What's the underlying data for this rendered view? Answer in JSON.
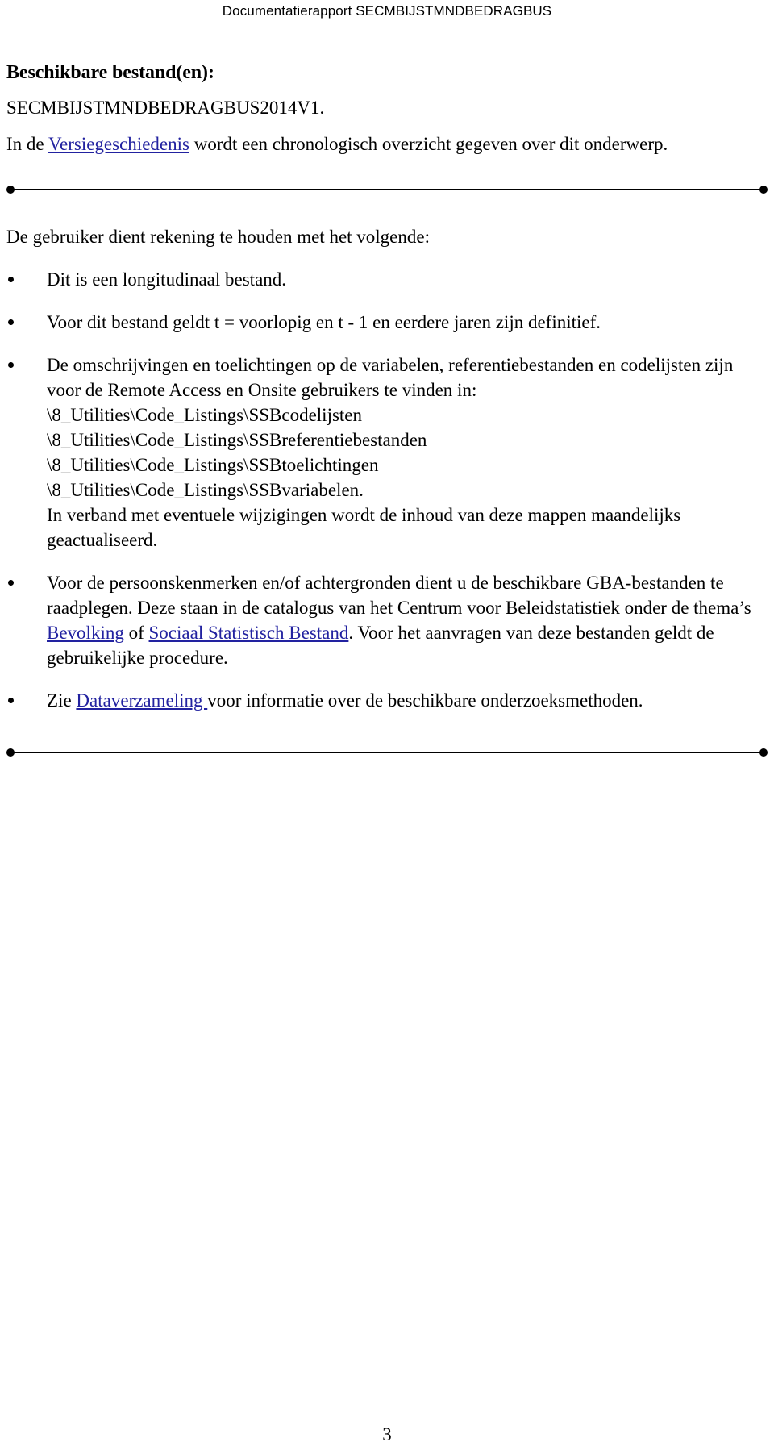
{
  "header": {
    "running_title": "Documentatierapport SECMBIJSTMNDBEDRAGBUS"
  },
  "content": {
    "heading_available_files": "Beschikbare bestand(en):",
    "file_name": "SECMBIJSTMNDBEDRAGBUS2014V1.",
    "version_history": {
      "prefix": "In de ",
      "link_text": "Versiegeschiedenis",
      "suffix": " wordt een chronologisch overzicht gegeven over dit onderwerp."
    },
    "lead_in": "De gebruiker dient rekening te houden met het volgende:",
    "bullets": [
      {
        "id": "longitudinal",
        "text": "Dit is een longitudinaal bestand."
      },
      {
        "id": "t-definitief",
        "text": "Voor dit bestand geldt t = voorlopig en t - 1 en eerdere jaren zijn definitief."
      },
      {
        "id": "omschrijvingen",
        "intro": "De omschrijvingen en toelichtingen op de variabelen, referentiebestanden en codelijsten zijn voor de Remote Access en Onsite gebruikers te vinden in:",
        "paths": [
          "\\8_Utilities\\Code_Listings\\SSBcodelijsten",
          "\\8_Utilities\\Code_Listings\\SSBreferentiebestanden",
          "\\8_Utilities\\Code_Listings\\SSBtoelichtingen",
          "\\8_Utilities\\Code_Listings\\SSBvariabelen."
        ],
        "outro": "In verband met eventuele wijzigingen wordt de inhoud van deze mappen maandelijks geactualiseerd."
      },
      {
        "id": "gba-bestanden",
        "part1": "Voor de persoonskenmerken en/of achtergronden dient u de beschikbare GBA-bestanden te raadplegen. Deze staan in de catalogus van het Centrum voor Beleidstatistiek onder de thema’s ",
        "link1": "Bevolking",
        "part2": " of ",
        "link2": "Sociaal Statistisch Bestand",
        "part3": ". Voor het aanvragen van deze bestanden geldt de gebruikelijke procedure."
      },
      {
        "id": "dataverzameling",
        "prefix": "Zie ",
        "link_text": "Dataverzameling ",
        "suffix": "voor informatie over de beschikbare onderzoeksmethoden."
      }
    ]
  },
  "footer": {
    "page_number": "3"
  },
  "colors": {
    "link": "#2222a0",
    "text": "#000000",
    "background": "#ffffff"
  }
}
